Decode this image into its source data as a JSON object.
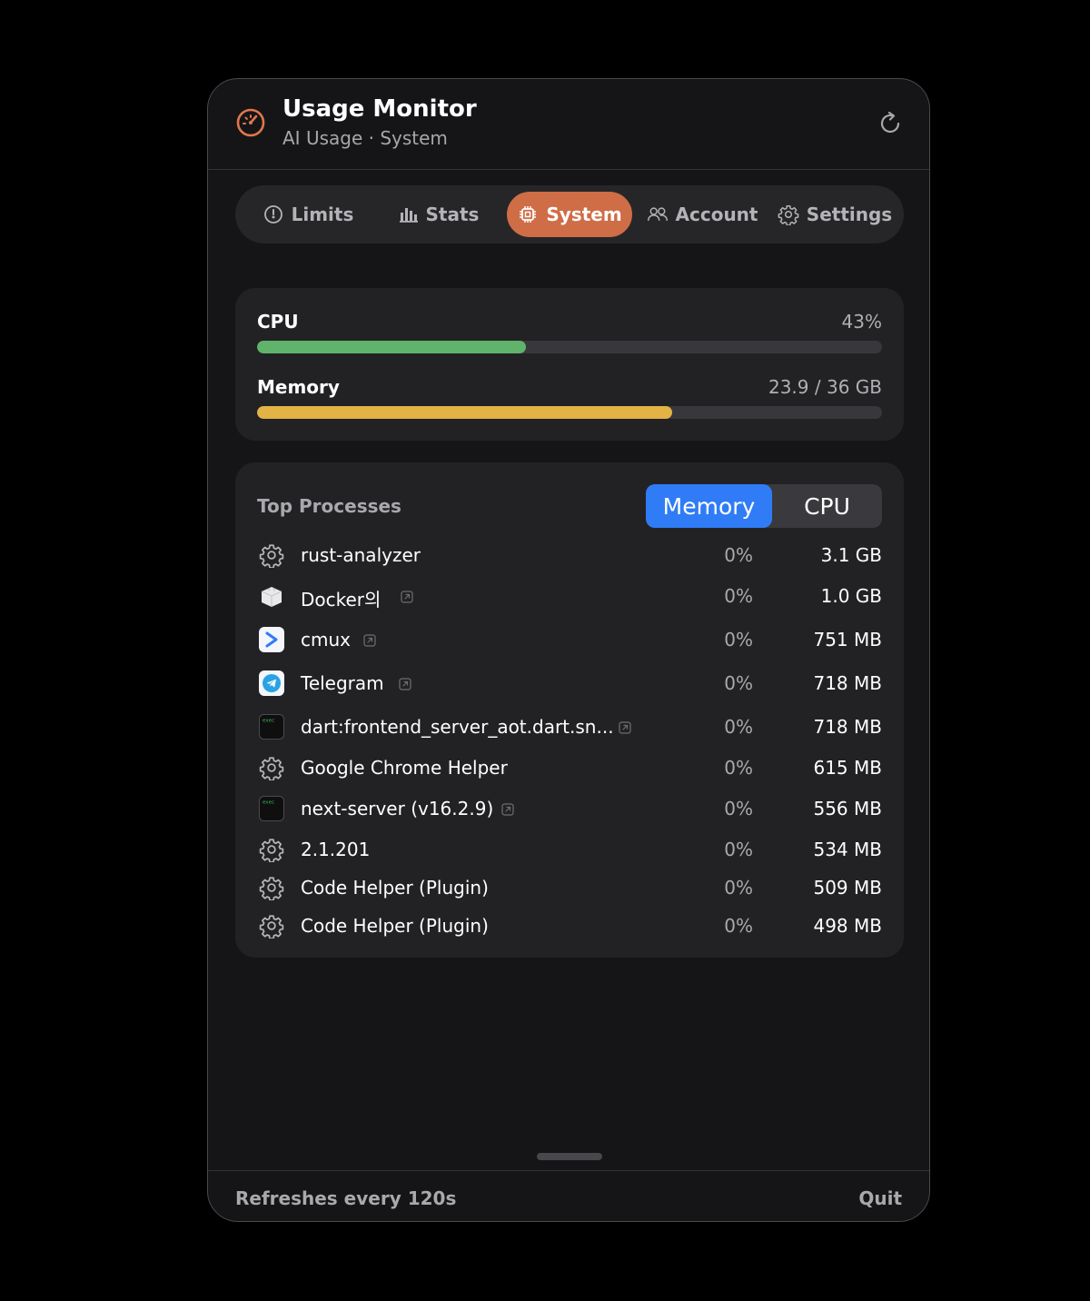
{
  "app": {
    "title": "Usage Monitor",
    "subtitle": "AI Usage · System",
    "accent": "#cf6d46"
  },
  "tabs": [
    {
      "label": "Limits",
      "icon": "gauge-icon"
    },
    {
      "label": "Stats",
      "icon": "bar-chart-icon"
    },
    {
      "label": "System",
      "icon": "chip-icon",
      "active": true
    },
    {
      "label": "Account",
      "icon": "users-icon"
    },
    {
      "label": "Settings",
      "icon": "gear-icon"
    }
  ],
  "usage": {
    "cpu": {
      "label": "CPU",
      "value": "43%",
      "fraction": 0.43,
      "color": "#5fb36a"
    },
    "memory": {
      "label": "Memory",
      "value": "23.9 / 36 GB",
      "fraction": 0.664,
      "color": "#e4b346"
    }
  },
  "processes": {
    "title": "Top Processes",
    "sort_options": [
      {
        "label": "Memory",
        "active": true
      },
      {
        "label": "CPU",
        "active": false
      }
    ],
    "rows": [
      {
        "name": "rust-analyzer",
        "icon": "gear-icon",
        "cpu": "0%",
        "mem": "3.1 GB",
        "link": false
      },
      {
        "name": "Docker의",
        "icon": "docker-box-icon",
        "cpu": "0%",
        "mem": "1.0 GB",
        "link": true
      },
      {
        "name": "cmux",
        "icon": "cmux-app-icon",
        "cpu": "0%",
        "mem": "751 MB",
        "link": true
      },
      {
        "name": "Telegram",
        "icon": "telegram-icon",
        "cpu": "0%",
        "mem": "718 MB",
        "link": true
      },
      {
        "name": "dart:frontend_server_aot.dart.sn...",
        "icon": "exec-terminal-icon",
        "cpu": "0%",
        "mem": "718 MB",
        "link": true
      },
      {
        "name": "Google Chrome Helper",
        "icon": "gear-icon",
        "cpu": "0%",
        "mem": "615 MB",
        "link": false
      },
      {
        "name": "next-server (v16.2.9)",
        "icon": "exec-terminal-icon",
        "cpu": "0%",
        "mem": "556 MB",
        "link": true
      },
      {
        "name": "2.1.201",
        "icon": "gear-icon",
        "cpu": "0%",
        "mem": "534 MB",
        "link": false
      },
      {
        "name": "Code Helper (Plugin)",
        "icon": "gear-icon",
        "cpu": "0%",
        "mem": "509 MB",
        "link": false
      },
      {
        "name": "Code Helper (Plugin)",
        "icon": "gear-icon",
        "cpu": "0%",
        "mem": "498 MB",
        "link": false
      }
    ]
  },
  "footer": {
    "refresh_text": "Refreshes every 120s",
    "quit_label": "Quit"
  }
}
